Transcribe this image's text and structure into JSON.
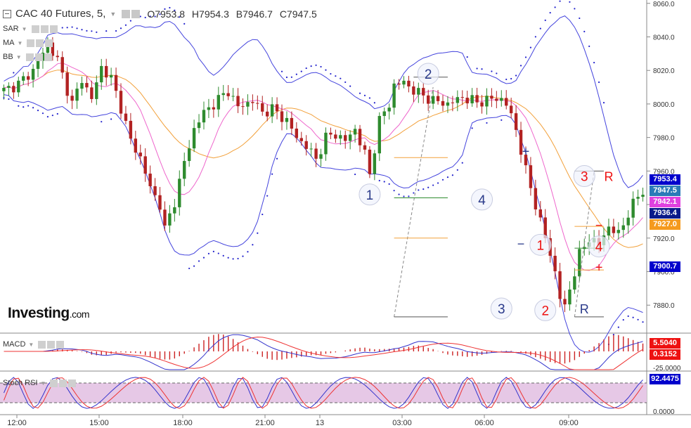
{
  "header": {
    "title": "CAC 40 Futures, 5,",
    "open": "O7953.8",
    "high": "H7954.3",
    "low": "B7946.7",
    "close": "C7947.5"
  },
  "indicators": {
    "sar": "SAR",
    "ma": "MA",
    "bb": "BB",
    "macd": "MACD",
    "stoch": "Stoch RSI"
  },
  "logo": {
    "main": "Investing",
    "suffix": ".com"
  },
  "price_badges": [
    {
      "value": "7953.4",
      "color": "#0000cc"
    },
    {
      "value": "7947.5",
      "color": "#2a7ab8"
    },
    {
      "value": "7942.1",
      "color": "#e040e0"
    },
    {
      "value": "7936.4",
      "color": "#0a1a8a"
    },
    {
      "value": "7927.0",
      "color": "#f59a1e"
    },
    {
      "value": "7900.7",
      "color": "#0000cc"
    }
  ],
  "macd_badges": [
    {
      "value": "5.5040",
      "color": "#ee1111"
    },
    {
      "value": "0.3152",
      "color": "#ee1111"
    }
  ],
  "stoch_badges": [
    {
      "value": "92.4475",
      "color": "#0000cc"
    }
  ],
  "chart_data": [
    {
      "type": "candlestick",
      "series": [
        {
          "name": "SAR",
          "color": "#2222cc"
        },
        {
          "name": "MA",
          "color": "#f2a03a"
        },
        {
          "name": "BB",
          "color": "#4444dd"
        }
      ],
      "ylim": [
        7865,
        8062
      ],
      "y_ticks": [
        "8060.0",
        "8040.0",
        "8020.0",
        "8000.0",
        "7980.0",
        "7960.0",
        "7940.0",
        "7920.0",
        "7900.0",
        "7880.0"
      ],
      "x_ticks": [
        "12:00",
        "15:00",
        "18:00",
        "21:00",
        "13",
        "03:00",
        "06:00",
        "09:00"
      ],
      "close_path": [
        [
          0,
          8008
        ],
        [
          3,
          8012
        ],
        [
          6,
          8020
        ],
        [
          9,
          8036
        ],
        [
          11,
          8026
        ],
        [
          14,
          8000
        ],
        [
          16,
          8015
        ],
        [
          18,
          8003
        ],
        [
          20,
          8022
        ],
        [
          22,
          8015
        ],
        [
          24,
          7998
        ],
        [
          26,
          7978
        ],
        [
          28,
          7968
        ],
        [
          30,
          7950
        ],
        [
          32,
          7940
        ],
        [
          33,
          7925
        ],
        [
          35,
          7942
        ],
        [
          37,
          7965
        ],
        [
          39,
          7985
        ],
        [
          41,
          7995
        ],
        [
          43,
          8000
        ],
        [
          46,
          8008
        ],
        [
          48,
          7998
        ],
        [
          51,
          8002
        ],
        [
          53,
          7995
        ],
        [
          55,
          7997
        ],
        [
          58,
          7990
        ],
        [
          60,
          7980
        ],
        [
          62,
          7975
        ],
        [
          64,
          7967
        ],
        [
          66,
          7980
        ],
        [
          68,
          7982
        ],
        [
          70,
          7978
        ],
        [
          72,
          7985
        ],
        [
          74,
          7970
        ],
        [
          75,
          7958
        ],
        [
          77,
          7990
        ],
        [
          79,
          8000
        ],
        [
          80,
          8011
        ],
        [
          82,
          8013
        ],
        [
          84,
          8008
        ],
        [
          86,
          8005
        ],
        [
          88,
          8002
        ],
        [
          91,
          8000
        ],
        [
          94,
          8004
        ],
        [
          97,
          8001
        ],
        [
          100,
          8003
        ],
        [
          102,
          8003
        ],
        [
          103,
          8000
        ],
        [
          105,
          7985
        ],
        [
          107,
          7960
        ],
        [
          109,
          7940
        ],
        [
          111,
          7920
        ],
        [
          113,
          7900
        ],
        [
          114,
          7885
        ],
        [
          115,
          7878
        ],
        [
          116,
          7890
        ],
        [
          118,
          7910
        ],
        [
          120,
          7920
        ],
        [
          122,
          7916
        ],
        [
          124,
          7927
        ],
        [
          126,
          7922
        ],
        [
          128,
          7935
        ],
        [
          130,
          7945
        ],
        [
          131,
          7948
        ]
      ],
      "annotations": [
        {
          "text": "1",
          "x": 75,
          "y": 7946,
          "style": "circle",
          "color": "#2a3a8a"
        },
        {
          "text": "2",
          "x": 87,
          "y": 8018,
          "style": "circle",
          "color": "#2a3a8a"
        },
        {
          "text": "3",
          "x": 102,
          "y": 7878,
          "style": "circle",
          "color": "#2a3a8a"
        },
        {
          "text": "4",
          "x": 98,
          "y": 7943,
          "style": "circle",
          "color": "#2a3a8a"
        },
        {
          "text": "1",
          "x": 110,
          "y": 7916,
          "style": "circle",
          "color": "#ee1111"
        },
        {
          "text": "2",
          "x": 111,
          "y": 7877,
          "style": "circle",
          "color": "#ee1111"
        },
        {
          "text": "3",
          "x": 119,
          "y": 7957,
          "style": "circle",
          "color": "#ee1111"
        },
        {
          "text": "4",
          "x": 122,
          "y": 7915,
          "style": "circle",
          "color": "#ee1111"
        },
        {
          "text": "R",
          "x": 119,
          "y": 7878,
          "style": "plain",
          "color": "#2a3a8a"
        },
        {
          "text": "R",
          "x": 124,
          "y": 7957,
          "style": "plain",
          "color": "#ee1111"
        },
        {
          "text": "+",
          "x": 107,
          "y": 7972,
          "style": "plain",
          "color": "#2a3a8a"
        },
        {
          "text": "−",
          "x": 106,
          "y": 7917,
          "style": "plain",
          "color": "#2a3a8a"
        },
        {
          "text": "−",
          "x": 122,
          "y": 7928,
          "style": "plain",
          "color": "#ee1111"
        },
        {
          "text": "+",
          "x": 122,
          "y": 7903,
          "style": "plain",
          "color": "#ee1111"
        }
      ]
    },
    {
      "type": "bar",
      "title": "MACD",
      "y_ticks": [
        "-25.0000"
      ]
    },
    {
      "type": "line",
      "title": "Stoch RSI",
      "y_ticks": [
        "0.0000"
      ]
    }
  ]
}
